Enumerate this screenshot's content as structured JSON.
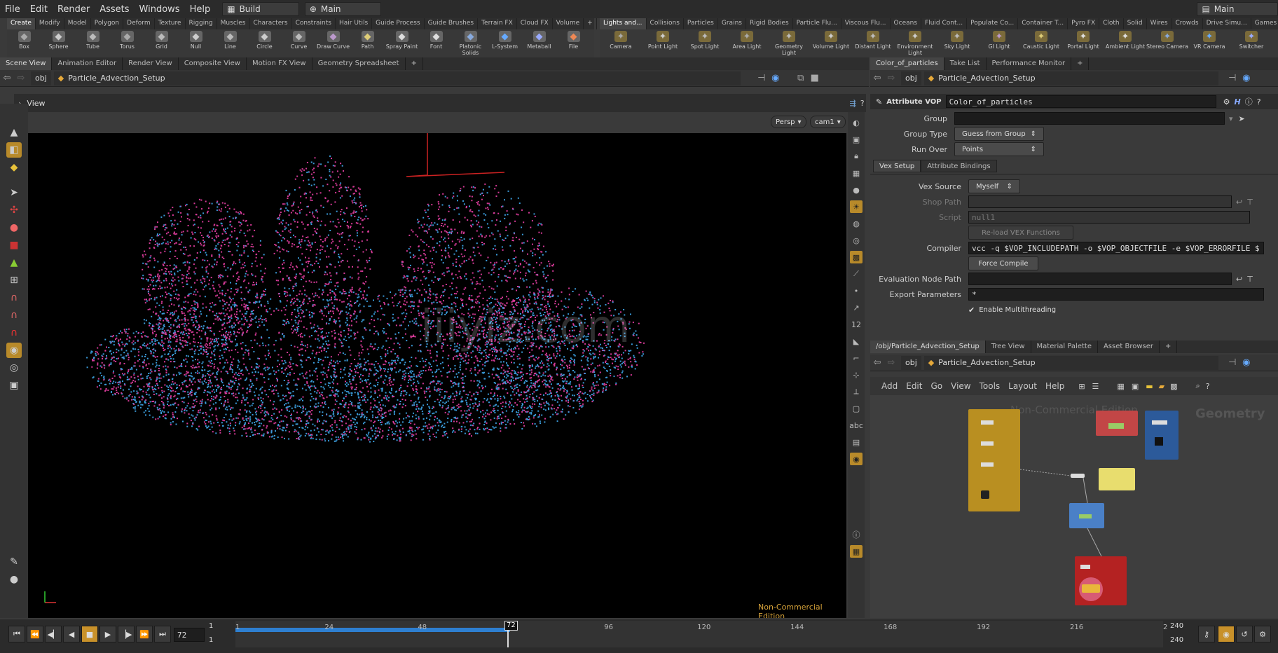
{
  "menubar": {
    "items": [
      "File",
      "Edit",
      "Render",
      "Assets",
      "Windows",
      "Help"
    ],
    "desktop": "Build",
    "desktop_main": "Main",
    "right_main": "Main"
  },
  "shelf_left": {
    "tabs": [
      "Create",
      "Modify",
      "Model",
      "Polygon",
      "Deform",
      "Texture",
      "Rigging",
      "Muscles",
      "Characters",
      "Constraints",
      "Hair Utils",
      "Guide Process",
      "Guide Brushes",
      "Terrain FX",
      "Cloud FX",
      "Volume"
    ],
    "tools": [
      "Box",
      "Sphere",
      "Tube",
      "Torus",
      "Grid",
      "Null",
      "Line",
      "Circle",
      "Curve",
      "Draw Curve",
      "Path",
      "Spray Paint",
      "Font",
      "Platonic Solids",
      "L-System",
      "Metaball",
      "File"
    ]
  },
  "shelf_right": {
    "tabs": [
      "Lights and...",
      "Collisions",
      "Particles",
      "Grains",
      "Rigid Bodies",
      "Particle Flu...",
      "Viscous Flu...",
      "Oceans",
      "Fluid Cont...",
      "Populate Co...",
      "Container T...",
      "Pyro FX",
      "Cloth",
      "Solid",
      "Wires",
      "Crowds",
      "Drive Simu...",
      "Games"
    ],
    "tools": [
      "Camera",
      "Point Light",
      "Spot Light",
      "Area Light",
      "Geometry Light",
      "Volume Light",
      "Distant Light",
      "Environment Light",
      "Sky Light",
      "GI Light",
      "Caustic Light",
      "Portal Light",
      "Ambient Light",
      "Stereo Camera",
      "VR Camera",
      "Switcher"
    ]
  },
  "left_pane": {
    "tabs": [
      "Scene View",
      "Animation Editor",
      "Render View",
      "Composite View",
      "Motion FX View",
      "Geometry Spreadsheet"
    ],
    "path_obj": "obj",
    "path_node": "Particle_Advection_Setup",
    "view_label": "View",
    "persp": "Persp",
    "cam": "cam1",
    "watermark": "Non-Commercial Edition",
    "overlay_text": "iiiyiz.com"
  },
  "params": {
    "tabs": [
      "Color_of_particles",
      "Take List",
      "Performance Monitor"
    ],
    "path_obj": "obj",
    "path_node": "Particle_Advection_Setup",
    "op_type": "Attribute VOP",
    "op_name": "Color_of_particles",
    "group_label": "Group",
    "group_type_label": "Group Type",
    "group_type": "Guess from Group",
    "run_over_label": "Run Over",
    "run_over": "Points",
    "subtabs": [
      "Vex Setup",
      "Attribute Bindings"
    ],
    "vex_source_label": "Vex Source",
    "vex_source": "Myself",
    "shop_path_label": "Shop Path",
    "script_label": "Script",
    "script_value": "null1",
    "reload_btn": "Re-load VEX Functions",
    "compiler_label": "Compiler",
    "compiler": "vcc -q $VOP_INCLUDEPATH -o $VOP_OBJECTFILE -e $VOP_ERRORFILE $",
    "force_compile": "Force Compile",
    "eval_path_label": "Evaluation Node Path",
    "export_label": "Export Parameters",
    "export_value": "*",
    "multithread": "Enable Multithreading"
  },
  "network": {
    "tabs": [
      "/obj/Particle_Advection_Setup",
      "Tree View",
      "Material Palette",
      "Asset Browser"
    ],
    "path_obj": "obj",
    "path_node": "Particle_Advection_Setup",
    "menu": [
      "Add",
      "Edit",
      "Go",
      "View",
      "Tools",
      "Layout",
      "Help"
    ],
    "watermark": "Non-Commercial Edition",
    "context": "Geometry"
  },
  "timeline": {
    "frame": "72",
    "start": "1",
    "start2": "1",
    "end": "240",
    "end2": "240",
    "ticks": [
      "1",
      "24",
      "48",
      "72",
      "96",
      "120",
      "144",
      "168",
      "192",
      "216",
      "2"
    ],
    "current": "72"
  }
}
